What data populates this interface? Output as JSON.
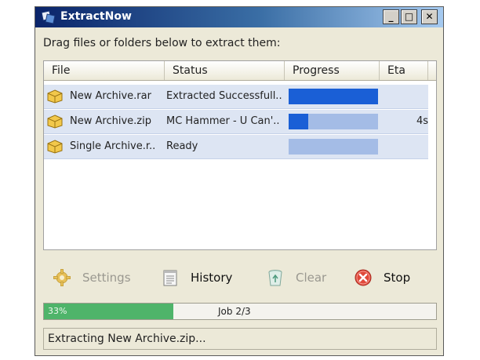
{
  "window": {
    "title": "ExtractNow"
  },
  "instruction": "Drag files or folders below to extract them:",
  "columns": {
    "file": "File",
    "status": "Status",
    "progress": "Progress",
    "eta": "Eta"
  },
  "rows": [
    {
      "file": "New Archive.rar",
      "status": "Extracted Successfull..",
      "progress": 1.0,
      "eta": ""
    },
    {
      "file": "New Archive.zip",
      "status": "MC Hammer - U Can'..",
      "progress": 0.22,
      "eta": "4s"
    },
    {
      "file": "Single Archive.r..",
      "status": "Ready",
      "progress": 0.0,
      "eta": ""
    }
  ],
  "toolbar": {
    "settings_label": "Settings",
    "history_label": "History",
    "clear_label": "Clear",
    "stop_label": "Stop"
  },
  "overall": {
    "percent_label": "33%",
    "percent": 33,
    "job_label": "Job 2/3"
  },
  "status_text": "Extracting New Archive.zip...",
  "colors": {
    "bar_fill": "#1a5fd6",
    "bar_empty": "#a4bce6",
    "overall_fill": "#4fb46a",
    "row_bg": "#dde5f3"
  },
  "icons": {
    "app": "extractnow-icon",
    "file": "archive-box-icon",
    "settings": "gear-icon",
    "history": "notepad-icon",
    "clear": "recycle-bin-icon",
    "stop": "stop-icon"
  }
}
